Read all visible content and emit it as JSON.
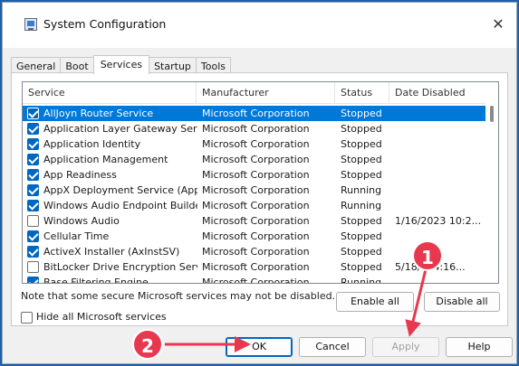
{
  "window": {
    "title": "System Configuration",
    "close_glyph": "✕"
  },
  "tabs": [
    {
      "label": "General",
      "active": false
    },
    {
      "label": "Boot",
      "active": false
    },
    {
      "label": "Services",
      "active": true
    },
    {
      "label": "Startup",
      "active": false
    },
    {
      "label": "Tools",
      "active": false
    }
  ],
  "columns": {
    "service": "Service",
    "manufacturer": "Manufacturer",
    "status": "Status",
    "date_disabled": "Date Disabled"
  },
  "services": [
    {
      "service": "AllJoyn Router Service",
      "manufacturer": "Microsoft Corporation",
      "status": "Stopped",
      "date": "",
      "checked": true,
      "selected": true
    },
    {
      "service": "Application Layer Gateway Service",
      "manufacturer": "Microsoft Corporation",
      "status": "Stopped",
      "date": "",
      "checked": true
    },
    {
      "service": "Application Identity",
      "manufacturer": "Microsoft Corporation",
      "status": "Stopped",
      "date": "",
      "checked": true
    },
    {
      "service": "Application Management",
      "manufacturer": "Microsoft Corporation",
      "status": "Stopped",
      "date": "",
      "checked": true
    },
    {
      "service": "App Readiness",
      "manufacturer": "Microsoft Corporation",
      "status": "Stopped",
      "date": "",
      "checked": true
    },
    {
      "service": "AppX Deployment Service (AppX...",
      "manufacturer": "Microsoft Corporation",
      "status": "Running",
      "date": "",
      "checked": true
    },
    {
      "service": "Windows Audio Endpoint Builder",
      "manufacturer": "Microsoft Corporation",
      "status": "Running",
      "date": "",
      "checked": true
    },
    {
      "service": "Windows Audio",
      "manufacturer": "Microsoft Corporation",
      "status": "Stopped",
      "date": "1/16/2023 10:2...",
      "checked": false
    },
    {
      "service": "Cellular Time",
      "manufacturer": "Microsoft Corporation",
      "status": "Stopped",
      "date": "",
      "checked": true
    },
    {
      "service": "ActiveX Installer (AxInstSV)",
      "manufacturer": "Microsoft Corporation",
      "status": "Stopped",
      "date": "",
      "checked": true
    },
    {
      "service": "BitLocker Drive Encryption Service",
      "manufacturer": "Microsoft Corporation",
      "status": "Stopped",
      "date": "5/18/... 4:16...",
      "checked": false
    },
    {
      "service": "Base Filtering Engine",
      "manufacturer": "Microsoft Corporation",
      "status": "Running",
      "date": "",
      "checked": true
    }
  ],
  "note": "Note that some secure Microsoft services may not be disabled.",
  "buttons": {
    "enable_all": "Enable all",
    "disable_all": "Disable all",
    "ok": "OK",
    "cancel": "Cancel",
    "apply": "Apply",
    "help": "Help"
  },
  "hide_ms": {
    "label": "Hide all Microsoft services",
    "checked": false
  },
  "callouts": [
    {
      "number": "1"
    },
    {
      "number": "2"
    }
  ],
  "colors": {
    "accent": "#0078d7",
    "callout": "#e8384f",
    "background": "#1f5fa8"
  }
}
